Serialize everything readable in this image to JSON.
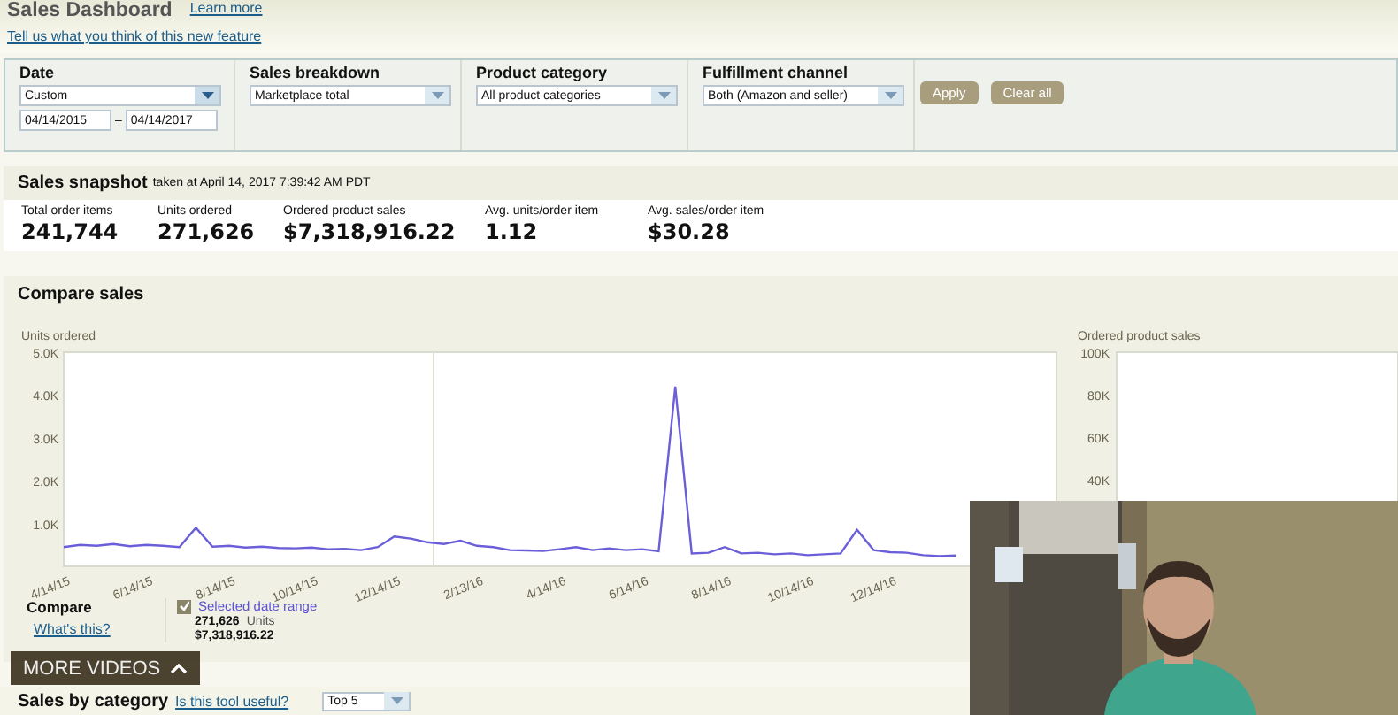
{
  "header": {
    "title": "Sales Dashboard",
    "learn_more": "Learn more",
    "feedback_link": "Tell us what you think of this new feature"
  },
  "filters": {
    "date": {
      "label": "Date",
      "value": "Custom",
      "from": "04/14/2015",
      "separator": "–",
      "to": "04/14/2017"
    },
    "dropdowns": [
      {
        "label": "Sales breakdown",
        "value": "Marketplace total"
      },
      {
        "label": "Product category",
        "value": "All product categories"
      },
      {
        "label": "Fulfillment channel",
        "value": "Both (Amazon and seller)"
      }
    ],
    "buttons": [
      "Apply",
      "Clear all"
    ]
  },
  "snapshot": {
    "title": "Sales snapshot",
    "taken_at": "taken at April 14, 2017 7:39:42 AM PDT",
    "metrics": [
      {
        "label": "Total order items",
        "value": "241,744"
      },
      {
        "label": "Units ordered",
        "value": "271,626"
      },
      {
        "label": "Ordered product sales",
        "value": "$7,318,916.22"
      },
      {
        "label": "Avg. units/order item",
        "value": "1.12"
      },
      {
        "label": "Avg. sales/order item",
        "value": "$30.28"
      }
    ]
  },
  "compare_sales": {
    "title": "Compare sales",
    "chart_data": {
      "type": "line",
      "ylabel": "Units ordered",
      "ylim": [
        0,
        5000
      ],
      "yticks": [
        {
          "value": 1000,
          "label": "1.0K"
        },
        {
          "value": 2000,
          "label": "2.0K"
        },
        {
          "value": 3000,
          "label": "3.0K"
        },
        {
          "value": 4000,
          "label": "4.0K"
        },
        {
          "value": 5000,
          "label": "5.0K"
        }
      ],
      "categories": [
        "4/14/15",
        null,
        null,
        null,
        null,
        "6/14/15",
        null,
        null,
        null,
        null,
        "8/14/15",
        null,
        null,
        null,
        null,
        "10/14/15",
        null,
        null,
        null,
        null,
        "12/14/15",
        null,
        null,
        null,
        null,
        "2/13/16",
        null,
        null,
        null,
        null,
        "4/14/16",
        null,
        null,
        null,
        null,
        "6/14/16",
        null,
        null,
        null,
        null,
        "8/14/16",
        null,
        null,
        null,
        null,
        "10/14/16",
        null,
        null,
        null,
        null,
        "12/14/16",
        null,
        null,
        null,
        null
      ],
      "series": [
        {
          "name": "Selected date range",
          "color": "#6a5fd8",
          "values": [
            450,
            500,
            480,
            520,
            470,
            500,
            480,
            450,
            900,
            460,
            480,
            440,
            460,
            430,
            420,
            440,
            400,
            410,
            380,
            450,
            700,
            650,
            560,
            520,
            600,
            480,
            450,
            380,
            370,
            360,
            400,
            450,
            380,
            420,
            380,
            400,
            350,
            4200,
            300,
            320,
            450,
            300,
            320,
            280,
            300,
            260,
            280,
            300,
            850,
            380,
            330,
            320,
            260,
            240,
            250
          ]
        }
      ]
    },
    "right_chart": {
      "title": "Ordered product sales",
      "yticks": [
        "100K",
        "80K",
        "60K",
        "40K"
      ]
    },
    "legend": {
      "title": "Compare",
      "help_link": "What's this?",
      "series": [
        {
          "checked": true,
          "units": "271,626",
          "units_label": "Units",
          "sales": "$7,318,916.22"
        }
      ]
    }
  },
  "sales_by_category": {
    "title": "Sales by category",
    "feedback_link": "Is this tool useful?",
    "top": "Top 5"
  },
  "video_overlay": {
    "more_videos": "MORE VIDEOS"
  }
}
